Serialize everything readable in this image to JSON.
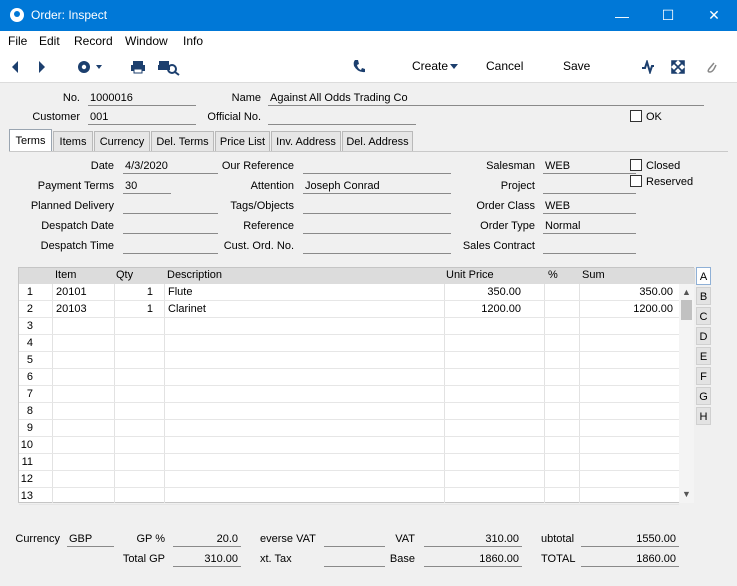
{
  "window": {
    "title": "Order: Inspect",
    "minimize": "—",
    "maximize": "☐",
    "close": "✕"
  },
  "menu": [
    "File",
    "Edit",
    "Record",
    "Window",
    "Info"
  ],
  "toolbar": {
    "create_label": "Create",
    "cancel_label": "Cancel",
    "save_label": "Save"
  },
  "header": {
    "no_label": "No.",
    "no_value": "1000016",
    "name_label": "Name",
    "name_value": "Against All Odds Trading Co",
    "customer_label": "Customer",
    "customer_value": "001",
    "official_label": "Official No.",
    "official_value": "",
    "ok_label": "OK"
  },
  "tabs": [
    "Terms",
    "Items",
    "Currency",
    "Del. Terms",
    "Price List",
    "Inv. Address",
    "Del. Address"
  ],
  "terms": {
    "date_label": "Date",
    "date_value": "4/3/2020",
    "payment_terms_label": "Payment Terms",
    "payment_terms_value": "30",
    "planned_delivery_label": "Planned Delivery",
    "planned_delivery_value": "",
    "despatch_date_label": "Despatch Date",
    "despatch_date_value": "",
    "despatch_time_label": "Despatch Time",
    "despatch_time_value": "",
    "our_ref_label": "Our Reference",
    "our_ref_value": "",
    "attention_label": "Attention",
    "attention_value": "Joseph Conrad",
    "tags_label": "Tags/Objects",
    "tags_value": "",
    "reference_label": "Reference",
    "reference_value": "",
    "cust_ord_label": "Cust. Ord. No.",
    "cust_ord_value": "",
    "salesman_label": "Salesman",
    "salesman_value": "WEB",
    "project_label": "Project",
    "project_value": "",
    "order_class_label": "Order Class",
    "order_class_value": "WEB",
    "order_type_label": "Order Type",
    "order_type_value": "Normal",
    "sales_contract_label": "Sales Contract",
    "sales_contract_value": "",
    "closed_label": "Closed",
    "reserved_label": "Reserved"
  },
  "grid": {
    "columns": [
      "Item",
      "Qty",
      "Description",
      "Unit Price",
      "%",
      "Sum"
    ],
    "rows": [
      {
        "n": "1",
        "item": "20101",
        "qty": "1",
        "desc": "Flute",
        "price": "350.00",
        "pct": "",
        "sum": "350.00"
      },
      {
        "n": "2",
        "item": "20103",
        "qty": "1",
        "desc": "Clarinet",
        "price": "1200.00",
        "pct": "",
        "sum": "1200.00"
      },
      {
        "n": "3",
        "item": "",
        "qty": "",
        "desc": "",
        "price": "",
        "pct": "",
        "sum": ""
      },
      {
        "n": "4",
        "item": "",
        "qty": "",
        "desc": "",
        "price": "",
        "pct": "",
        "sum": ""
      },
      {
        "n": "5",
        "item": "",
        "qty": "",
        "desc": "",
        "price": "",
        "pct": "",
        "sum": ""
      },
      {
        "n": "6",
        "item": "",
        "qty": "",
        "desc": "",
        "price": "",
        "pct": "",
        "sum": ""
      },
      {
        "n": "7",
        "item": "",
        "qty": "",
        "desc": "",
        "price": "",
        "pct": "",
        "sum": ""
      },
      {
        "n": "8",
        "item": "",
        "qty": "",
        "desc": "",
        "price": "",
        "pct": "",
        "sum": ""
      },
      {
        "n": "9",
        "item": "",
        "qty": "",
        "desc": "",
        "price": "",
        "pct": "",
        "sum": ""
      },
      {
        "n": "10",
        "item": "",
        "qty": "",
        "desc": "",
        "price": "",
        "pct": "",
        "sum": ""
      },
      {
        "n": "11",
        "item": "",
        "qty": "",
        "desc": "",
        "price": "",
        "pct": "",
        "sum": ""
      },
      {
        "n": "12",
        "item": "",
        "qty": "",
        "desc": "",
        "price": "",
        "pct": "",
        "sum": ""
      },
      {
        "n": "13",
        "item": "",
        "qty": "",
        "desc": "",
        "price": "",
        "pct": "",
        "sum": ""
      }
    ],
    "side_tabs": [
      "A",
      "B",
      "C",
      "D",
      "E",
      "F",
      "G",
      "H"
    ]
  },
  "footer": {
    "currency_label": "Currency",
    "currency_value": "GBP",
    "gp_pct_label": "GP %",
    "gp_pct_value": "20.0",
    "total_gp_label": "Total GP",
    "total_gp_value": "310.00",
    "reverse_vat_label": "everse VAT",
    "reverse_vat_value": "",
    "ext_tax_label": "xt. Tax",
    "ext_tax_value": "",
    "vat_label": "VAT",
    "vat_value": "310.00",
    "base_label": "Base",
    "base_value": "1860.00",
    "subtotal_label": "ubtotal",
    "subtotal_value": "1550.00",
    "total_label": "TOTAL",
    "total_value": "1860.00"
  }
}
